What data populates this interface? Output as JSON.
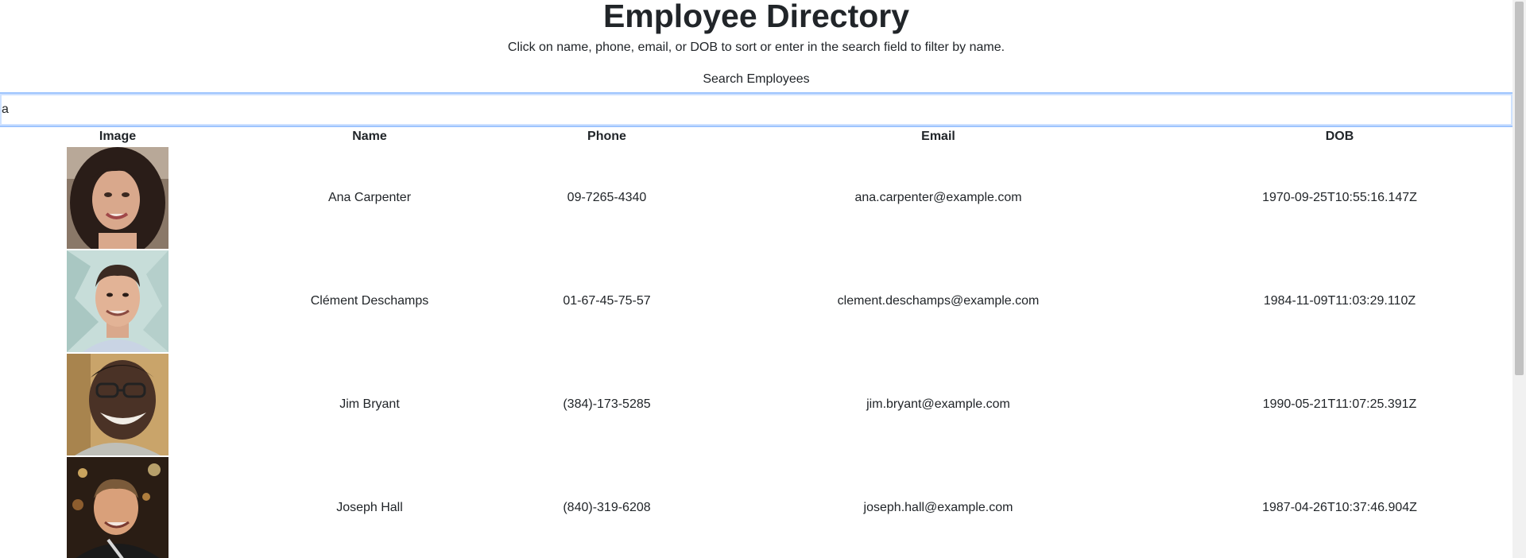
{
  "header": {
    "title": "Employee Directory",
    "subtitle": "Click on name, phone, email, or DOB to sort or enter in the search field to filter by name."
  },
  "search": {
    "label": "Search Employees",
    "value": "a"
  },
  "table": {
    "headers": {
      "image": "Image",
      "name": "Name",
      "phone": "Phone",
      "email": "Email",
      "dob": "DOB"
    },
    "rows": [
      {
        "name": "Ana Carpenter",
        "phone": "09-7265-4340",
        "email": "ana.carpenter@example.com",
        "dob": "1970-09-25T10:55:16.147Z",
        "photo_icon": "woman-portrait-photo"
      },
      {
        "name": "Clément Deschamps",
        "phone": "01-67-45-75-57",
        "email": "clement.deschamps@example.com",
        "dob": "1984-11-09T11:03:29.110Z",
        "photo_icon": "man-portrait-photo"
      },
      {
        "name": "Jim Bryant",
        "phone": "(384)-173-5285",
        "email": "jim.bryant@example.com",
        "dob": "1990-05-21T11:07:25.391Z",
        "photo_icon": "man-glasses-portrait-photo"
      },
      {
        "name": "Joseph Hall",
        "phone": "(840)-319-6208",
        "email": "joseph.hall@example.com",
        "dob": "1987-04-26T10:37:46.904Z",
        "photo_icon": "man-night-portrait-photo"
      }
    ]
  },
  "colors": {
    "text": "#212529",
    "search_border": "#9ec5fe",
    "scrollbar_track": "#f1f1f1",
    "scrollbar_thumb": "#c1c1c1"
  }
}
